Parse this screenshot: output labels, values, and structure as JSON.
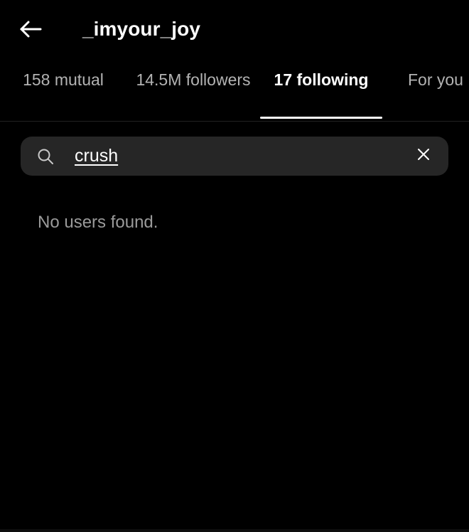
{
  "theme": {
    "background": "#000000",
    "search_field_background": "#262626",
    "active_text": "#ffffff",
    "inactive_text": "#b3b3b3",
    "muted_text": "#9a9a9a",
    "divider": "#222222"
  },
  "header": {
    "back_icon": "back-arrow-icon",
    "title": "_imyour_joy"
  },
  "tabs": [
    {
      "label": "158 mutual",
      "active": false
    },
    {
      "label": "14.5M followers",
      "active": false
    },
    {
      "label": "17 following",
      "active": true
    },
    {
      "label": "For you",
      "active": false
    }
  ],
  "search": {
    "search_icon": "search-icon",
    "value": "crush",
    "placeholder": "Search",
    "clear_icon": "close-icon"
  },
  "results": {
    "empty_message": "No users found."
  }
}
